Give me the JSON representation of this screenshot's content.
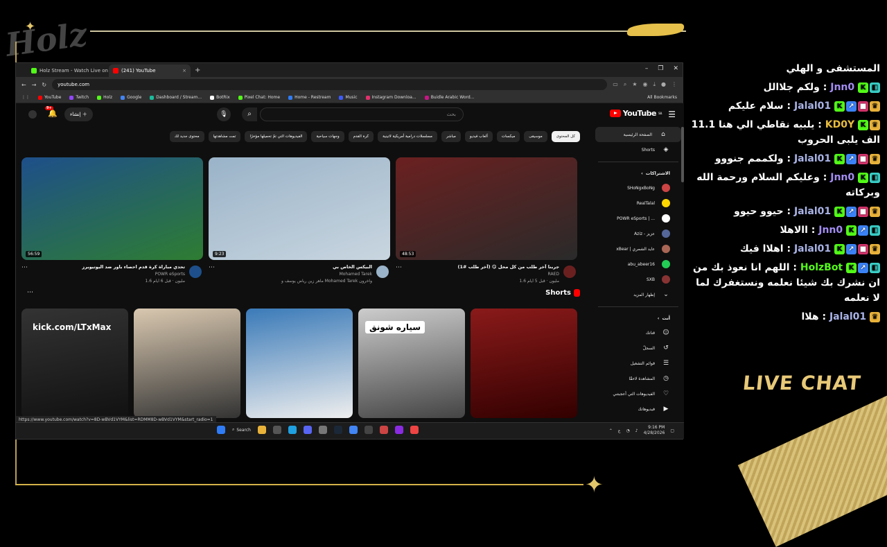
{
  "browser": {
    "tabs": [
      {
        "label": "Holz Stream - Watch Live on Ki",
        "color": "#53fc18"
      },
      {
        "label": "(241) YouTube",
        "color": "#ff0000"
      }
    ],
    "url": "youtube.com",
    "bookmarks": [
      {
        "label": "YouTube",
        "color": "#ff0000"
      },
      {
        "label": "Twitch",
        "color": "#9146ff"
      },
      {
        "label": "Holz",
        "color": "#53fc18"
      },
      {
        "label": "Google",
        "color": "#4285f4"
      },
      {
        "label": "Dashboard / Stream...",
        "color": "#1abc9c"
      },
      {
        "label": "BotRix",
        "color": "#ffffff"
      },
      {
        "label": "Pixel Chat: Home",
        "color": "#53fc18"
      },
      {
        "label": "Home - Restream",
        "color": "#2f7cf6"
      },
      {
        "label": "Music",
        "color": "#3b5bfd"
      },
      {
        "label": "Instagram Downloa...",
        "color": "#e1306c"
      },
      {
        "label": "Buidle Arabic Word...",
        "color": "#c71585"
      }
    ],
    "all_bookmarks": "All Bookmarks",
    "status_url": "https://www.youtube.com/watch?v=8D-wBVd1VYM&list=RDMM8D-wBVd1VYM&start_radio=1"
  },
  "youtube": {
    "logo": "YouTube",
    "logo_region": "SA",
    "search_placeholder": "بحث",
    "create_label": "إنشاء",
    "notification_count": "9+",
    "chips": [
      {
        "label": "كل المحتوى",
        "selected": true
      },
      {
        "label": "موسيقى"
      },
      {
        "label": "ميكسات"
      },
      {
        "label": "ألعاب فيديو"
      },
      {
        "label": "مباشر"
      },
      {
        "label": "مسلسلات درامية أمريكية لاتينية"
      },
      {
        "label": "كرة القدم"
      },
      {
        "label": "وجهات سياحية"
      },
      {
        "label": "الفيديوهات التي تمّ تحميلها مؤخرًا"
      },
      {
        "label": "تمت مشاهدتها"
      },
      {
        "label": "محتوى جديد لك"
      }
    ],
    "sidebar": {
      "main": [
        {
          "label": "الصفحة الرئيسية",
          "icon": "home-icon",
          "glyph": "⌂"
        },
        {
          "label": "Shorts",
          "icon": "shorts-icon",
          "glyph": "◈"
        }
      ],
      "subs_header": "الاشتراكات",
      "subs": [
        {
          "label": "SHoNgxBoNg",
          "color": "#c44"
        },
        {
          "label": "RealTalal",
          "color": "#ffd700"
        },
        {
          "label": "POWR eSports | ...",
          "color": "#fff"
        },
        {
          "label": "Aziz - عزيز",
          "color": "#569"
        },
        {
          "label": "xBear | عايد الشمري",
          "color": "#a65"
        },
        {
          "label": "abu_abeer16",
          "color": "#2c5"
        },
        {
          "label": "SXB",
          "color": "#833"
        }
      ],
      "show_more": "إظهار المزيد",
      "you_header": "أنت",
      "you": [
        {
          "label": "قناتك",
          "glyph": "☺"
        },
        {
          "label": "السجلّ",
          "glyph": "↺"
        },
        {
          "label": "قوائم التشغيل",
          "glyph": "☰"
        },
        {
          "label": "المشاهدة لاحقًا",
          "glyph": "◷"
        },
        {
          "label": "الفيديوهات التي أعجبتني",
          "glyph": "♡"
        },
        {
          "label": "فيديوهاتك",
          "glyph": "▶"
        }
      ]
    },
    "videos": [
      {
        "title": "جربنا آخر طلب من كل محل 😋 (آخر طلب #1)",
        "channel": "RAED",
        "meta": "1.6 مليون · قبل 5 أيام",
        "duration": "48:53",
        "colors": [
          "#6b2020",
          "#2a2a2a"
        ]
      },
      {
        "title": "البيكس الخاص بي",
        "channel": "Mohamed Tarek",
        "meta": "ماهر زين رياض يوسف و Mohamed Tarek وآخرون",
        "duration": "9:23",
        "colors": [
          "#9ab3c8",
          "#c9d6e0"
        ]
      },
      {
        "title": "تحدي مباراة كرة قدم احصاء باور ضد اليوتيوبرز",
        "channel": "POWR eSports",
        "meta": "1.6 مليون · قبل 6 أيام",
        "duration": "56:59",
        "colors": [
          "#1e4f8a",
          "#2e7d32"
        ]
      }
    ],
    "shorts_label": "Shorts",
    "shorts": [
      {
        "caption": "",
        "colors": [
          "#8a1a1a",
          "#300"
        ]
      },
      {
        "caption": "سياره شونق",
        "colors": [
          "#ccc",
          "#444"
        ]
      },
      {
        "caption": "",
        "colors": [
          "#3a7ab8",
          "#eee"
        ]
      },
      {
        "caption": "",
        "colors": [
          "#d9c8b0",
          "#333"
        ]
      },
      {
        "caption": "kick.com/LTxMax",
        "colors": [
          "#333",
          "#111"
        ]
      }
    ]
  },
  "taskbar": {
    "search": "Search",
    "time": "9:16 PM",
    "date": "4/28/2026",
    "lang": "ع"
  },
  "chat": {
    "title": "LIVE CHAT",
    "messages": [
      {
        "user": "",
        "user_color": "#fff",
        "badges": [],
        "text": "المستشفى و الهلي"
      },
      {
        "user": "Jnn0",
        "user_color": "#a38df2",
        "badges": [
          "k",
          "g"
        ],
        "text": "ولكم جلاالل"
      },
      {
        "user": "Jalal01",
        "user_color": "#a9b3e6",
        "badges": [
          "k",
          "a",
          "r",
          "c"
        ],
        "text": "سلام عليكم"
      },
      {
        "user": "KD0Y",
        "user_color": "#e8bd3e",
        "badges": [
          "k",
          "c"
        ],
        "text": "يلبيه نقاطي الي هنا 11.1 الف يلبى الحروب"
      },
      {
        "user": "Jalal01",
        "user_color": "#a9b3e6",
        "badges": [
          "k",
          "a",
          "r",
          "c"
        ],
        "text": "ولكممم جنووو"
      },
      {
        "user": "Jnn0",
        "user_color": "#a38df2",
        "badges": [
          "k",
          "g"
        ],
        "text": "وعليكم السلام ورحمة الله وبركاته"
      },
      {
        "user": "Jalal01",
        "user_color": "#a9b3e6",
        "badges": [
          "k",
          "a",
          "r",
          "c"
        ],
        "text": "حيوو حيوو"
      },
      {
        "user": "Jnn0",
        "user_color": "#a38df2",
        "badges": [
          "k",
          "a",
          "g"
        ],
        "text": "االاهلا"
      },
      {
        "user": "Jalal01",
        "user_color": "#a9b3e6",
        "badges": [
          "k",
          "a",
          "r",
          "c"
        ],
        "text": "اهلاا فيك"
      },
      {
        "user": "HolzBot",
        "user_color": "#53fc18",
        "badges": [
          "k",
          "a",
          "g"
        ],
        "text": "اللهم انا نعوذ بك من ان نشرك بك شيئا نعلمه ونستغفرك لما لا نعلمه"
      },
      {
        "user": "Jalal01",
        "user_color": "#a9b3e6",
        "badges": [
          "c"
        ],
        "text": "هلاا"
      }
    ]
  },
  "brand": {
    "logo": "Holz",
    "accent": "#e8c978"
  }
}
